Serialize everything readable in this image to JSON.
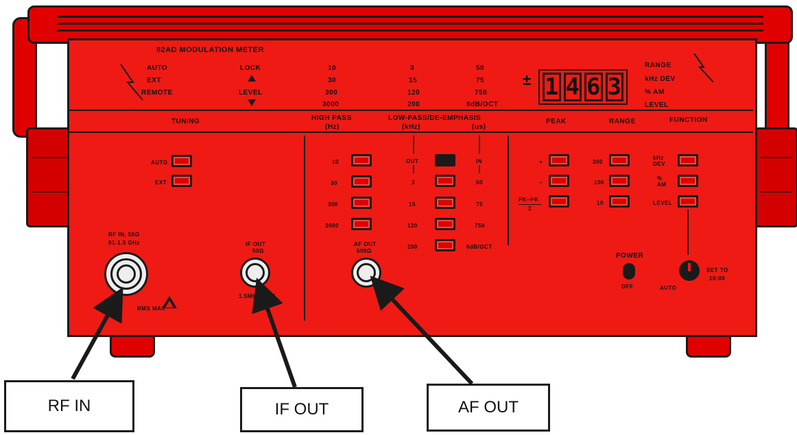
{
  "panel": {
    "model": "82AD MODULATION METER",
    "mode_labels": [
      "AUTO",
      "EXT",
      "REMOTE"
    ],
    "lock": "LOCK",
    "level": "LEVEL",
    "highpass_range_col": [
      "10",
      "30",
      "300",
      "3000"
    ],
    "lowpass_range_col": [
      "3",
      "15",
      "120",
      "200"
    ],
    "deemph_range_col": [
      "50",
      "75",
      "750",
      "6dB/OCT"
    ],
    "right_labels": [
      "RANGE",
      "kHz DEV",
      "% AM",
      "LEVEL"
    ],
    "display_sign": "±",
    "display_digits": [
      "1",
      "4",
      "6",
      "3"
    ]
  },
  "sections": {
    "tuning": "TUNING",
    "high_pass": "HIGH PASS",
    "high_pass_unit": "(Hz)",
    "low_pass": "LOW-PASS/DE-EMPHASIS",
    "low_pass_unit_khz": "(kHz)",
    "low_pass_unit_us": "(us)",
    "peak": "PEAK",
    "range": "RANGE",
    "function": "FUNCTION"
  },
  "tuning": {
    "buttons": [
      "AUTO",
      "EXT"
    ]
  },
  "high_pass_buttons": [
    "10",
    "30",
    "300",
    "3000"
  ],
  "low_pass": {
    "out_label": "OUT",
    "in_label": "IN",
    "left_labels": [
      "3",
      "15",
      "120",
      "200"
    ],
    "right_labels": [
      "50",
      "75",
      "750",
      "6dB/OCT"
    ]
  },
  "peak_buttons": [
    "+",
    "−",
    "PK−PK"
  ],
  "peak_pk_den": "2",
  "range_buttons": [
    "300",
    "100",
    "10"
  ],
  "function_buttons": [
    "kHz DEV",
    "% AM",
    "LEVEL"
  ],
  "connectors": {
    "rf_in_line1": "RF IN, 50Ω",
    "rf_in_line2": "01-1.5 GHz",
    "rms_max": "RMS MAX",
    "if_out_line1": "IF OUT",
    "if_out_line2": "50Ω",
    "if_freq": "1.5MHz NOM",
    "af_out_line1": "AF OUT",
    "af_out_line2": "600Ω"
  },
  "power": {
    "label": "POWER",
    "off": "OFF"
  },
  "set_knob": {
    "auto": "AUTO",
    "set_to": "SET TO",
    "time": "10:00"
  },
  "callouts": {
    "rf_in": "RF IN",
    "if_out": "IF OUT",
    "af_out": "AF OUT"
  },
  "colors": {
    "body": "#ef1a14",
    "outline": "#1a1a1a",
    "background": "#ffffff"
  }
}
